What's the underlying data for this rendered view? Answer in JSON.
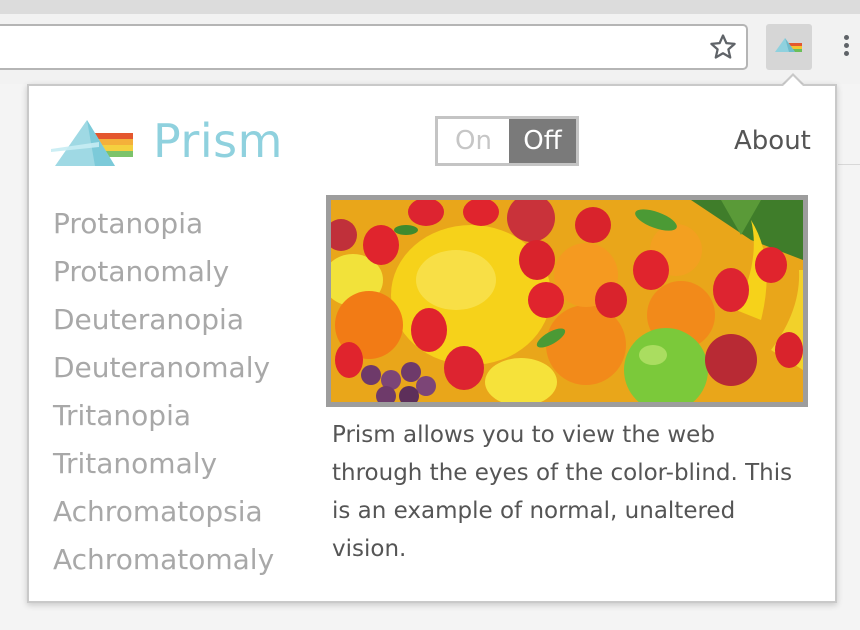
{
  "browser": {
    "star_icon": "bookmark-star-icon",
    "extension_icon": "prism-extension-icon",
    "menu_icon": "more-vertical-icon"
  },
  "popup": {
    "brand_name": "Prism",
    "toggle": {
      "on_label": "On",
      "off_label": "Off",
      "selected": "Off"
    },
    "about_label": "About",
    "modes": [
      "Protanopia",
      "Protanomaly",
      "Deuteranopia",
      "Deuteranomaly",
      "Tritanopia",
      "Tritanomaly",
      "Achromatopsia",
      "Achromatomaly"
    ],
    "description": "Prism allows you to view the web through the eyes of the color-blind. This is an example of normal, unaltered vision.",
    "colors": {
      "brand": "#8fd1de",
      "toggle_active_bg": "#7a7a7a",
      "mode_text": "#a8a8a8",
      "body_text": "#555555"
    }
  }
}
